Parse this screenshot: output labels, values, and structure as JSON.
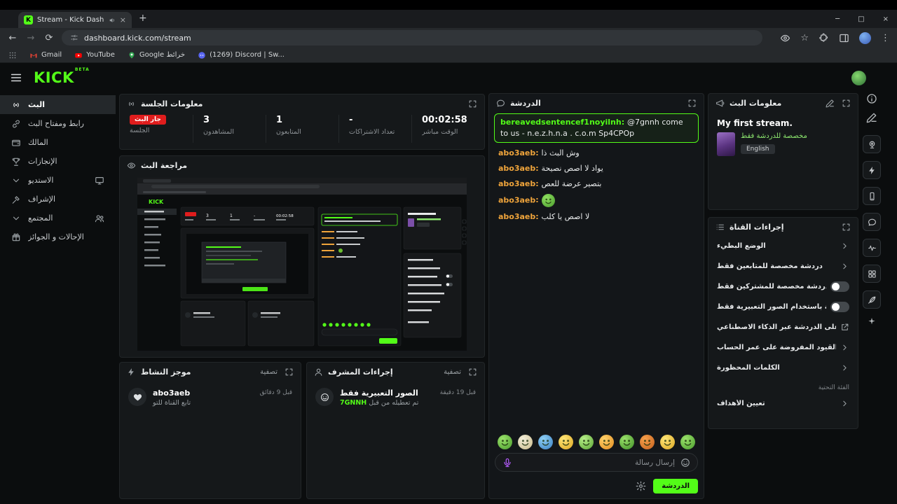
{
  "browser": {
    "tab_title": "Stream - Kick Dashboard",
    "tab_favicon": "K",
    "url": "dashboard.kick.com/stream",
    "bookmarks": [
      "Gmail",
      "YouTube",
      "Google خرائط",
      "(1269) Discord | Sw..."
    ]
  },
  "app": {
    "logo": "KICK",
    "beta": "BETA",
    "sidebar": [
      {
        "label": "البث",
        "icon": "broadcast-icon"
      },
      {
        "label": "رابط ومفتاح البث",
        "icon": "link-icon"
      },
      {
        "label": "المالك",
        "icon": "wallet-icon"
      },
      {
        "label": "الإنجازات",
        "icon": "trophy-icon"
      },
      {
        "label": "الاستديو",
        "icon": "chevron-down-icon",
        "trailing_icon": "monitor-icon"
      },
      {
        "label": "الإشراف",
        "icon": "gavel-icon"
      },
      {
        "label": "المجتمع",
        "icon": "chevron-down-icon",
        "trailing_icon": "people-icon"
      },
      {
        "label": "الإحالات و الجوائز",
        "icon": "gift-icon"
      }
    ],
    "session": {
      "title": "معلومات الجلسة",
      "live_badge": "جار البث",
      "stats": [
        {
          "value": "",
          "label": "الجلسة"
        },
        {
          "value": "3",
          "label": "المشاهدون"
        },
        {
          "value": "1",
          "label": "المتابعون"
        },
        {
          "value": "-",
          "label": "تعداد الاشتراكات"
        },
        {
          "value": "00:02:58",
          "label": "الوقت مباشر"
        }
      ]
    },
    "preview": {
      "title": "مراجعة البث"
    },
    "activity": {
      "title": "موجز النشاط",
      "filter": "تصفية",
      "item": {
        "user": "abo3aeb",
        "action": "تابع القناة للتو",
        "time": "قبل 9 دقائق"
      }
    },
    "mod_actions": {
      "title": "إجراءات المشرف",
      "filter": "تصفية",
      "item": {
        "title": "الصور التعبيرية فقط",
        "desc": "تم تعطيله من قبل",
        "by": "7GNNH",
        "time": "قبل 19 دقيقة"
      }
    },
    "chat": {
      "title": "الدردشة",
      "messages": [
        {
          "user": "bereavedsentencef1noyilnh",
          "text": "@7gnnh come to us - n.e.z.h.n.a . c.o.m Sp4CPOp",
          "highlighted": true
        },
        {
          "user": "abo3aeb",
          "text": "وش البث ذا"
        },
        {
          "user": "abo3aeb",
          "text": "يواد لا اصص نصيحة"
        },
        {
          "user": "abo3aeb",
          "text": "بتصير عرضة للعص"
        },
        {
          "user": "abo3aeb",
          "text": "",
          "emote": "frog-emote"
        },
        {
          "user": "abo3aeb",
          "text": "لا اصص يا كلب"
        }
      ],
      "quick_emotes": [
        "frog-emote",
        "scroll-emote",
        "globe-emote",
        "grin-emote",
        "ball-emote",
        "cool-emote",
        "smile-emote",
        "pumpkin-emote",
        "laugh-emote",
        "wink-emote"
      ],
      "input_placeholder": "إرسال رسالة",
      "send_button": "الدردشة"
    },
    "stream_info": {
      "title": "معلومات البث",
      "stream_title": "My first stream.",
      "category": "مخصصة للدردشة فقط",
      "language": "English"
    },
    "channel_actions": {
      "title": "إجراءات القناة",
      "rows": [
        {
          "label": "الوضع البطيء",
          "control": "chevron"
        },
        {
          "label": "دردشة مخصصة للمتابعين فقط",
          "control": "chevron"
        },
        {
          "label": "الدردشة مخصصة للمشتركين فقط",
          "control": "toggle",
          "on": false
        },
        {
          "label": "الدردشة باستخدام الصور التعبيرية فقط",
          "control": "toggle",
          "on": false
        },
        {
          "label": "الإشراف على الدردشة عبر الذكاء الاصطناعي",
          "control": "external"
        },
        {
          "label": "القيود المفروضة على عمر الحساب",
          "control": "chevron"
        },
        {
          "label": "الكلمات المحظورة",
          "control": "chevron"
        }
      ],
      "section_label": "الفئة التحتية",
      "goals_row": {
        "label": "تعيين الأهداف",
        "control": "chevron"
      }
    },
    "colors": {
      "accent": "#53fc18",
      "live": "#e01d1d",
      "chat_username": "#efa43b"
    }
  }
}
